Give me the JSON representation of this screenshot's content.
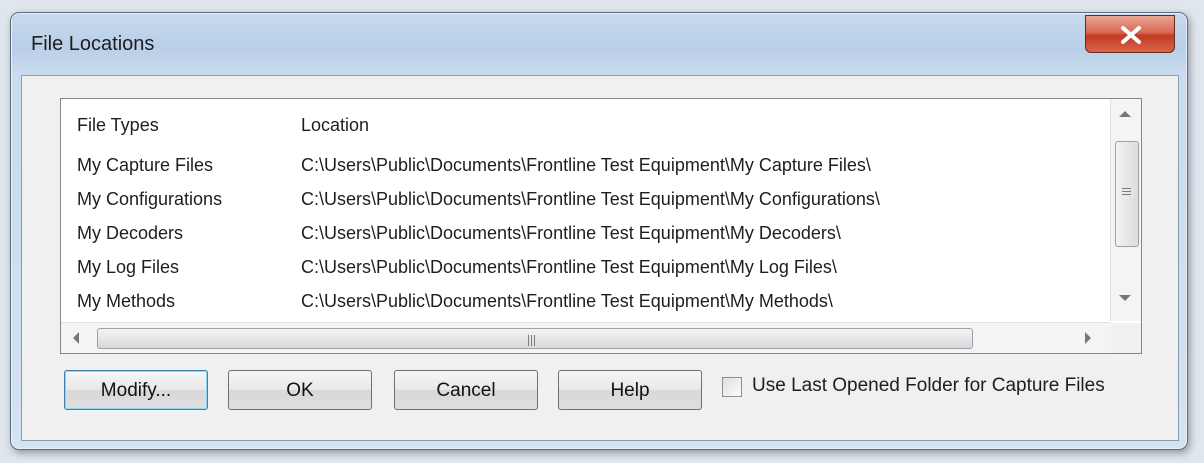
{
  "window": {
    "title": "File Locations"
  },
  "list": {
    "columns": [
      "File Types",
      "Location"
    ],
    "rows": [
      {
        "type": "My Capture Files",
        "location": "C:\\Users\\Public\\Documents\\Frontline Test Equipment\\My Capture Files\\"
      },
      {
        "type": "My Configurations",
        "location": "C:\\Users\\Public\\Documents\\Frontline Test Equipment\\My Configurations\\"
      },
      {
        "type": "My Decoders",
        "location": "C:\\Users\\Public\\Documents\\Frontline Test Equipment\\My Decoders\\"
      },
      {
        "type": "My Log Files",
        "location": "C:\\Users\\Public\\Documents\\Frontline Test Equipment\\My Log Files\\"
      },
      {
        "type": "My Methods",
        "location": "C:\\Users\\Public\\Documents\\Frontline Test Equipment\\My Methods\\"
      }
    ]
  },
  "buttons": {
    "modify": "Modify...",
    "ok": "OK",
    "cancel": "Cancel",
    "help": "Help"
  },
  "checkbox": {
    "label": "Use Last Opened Folder for Capture Files",
    "checked": false
  },
  "icons": {
    "close": "close-icon",
    "scroll_up": "scroll-up-arrow-icon",
    "scroll_down": "scroll-down-arrow-icon",
    "scroll_left": "scroll-left-arrow-icon",
    "scroll_right": "scroll-right-arrow-icon"
  },
  "colors": {
    "title_bar": "#c7d9ee",
    "close_button": "#c13a22",
    "default_button_border": "#3c7fb1"
  }
}
